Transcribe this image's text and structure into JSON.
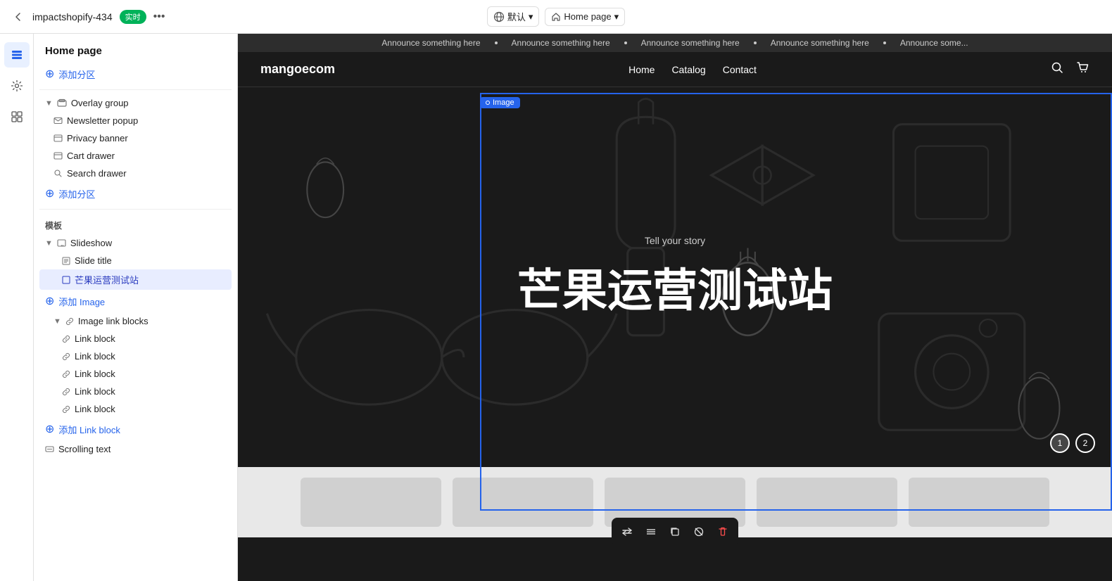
{
  "topbar": {
    "back_icon": "←",
    "store_name": "impactshopify-434",
    "live_badge": "实时",
    "more_icon": "•••",
    "lang_label": "默认",
    "lang_dropdown_icon": "▾",
    "page_label": "Home page",
    "page_dropdown_icon": "▾"
  },
  "sidebar_icons": [
    {
      "name": "layers-icon",
      "icon": "☰",
      "active": true
    },
    {
      "name": "settings-icon",
      "icon": "⚙"
    },
    {
      "name": "apps-icon",
      "icon": "⊞"
    }
  ],
  "left_panel": {
    "title": "Home page",
    "add_section_1_label": "添加分区",
    "overlay_group_label": "Overlay group",
    "overlay_items": [
      {
        "label": "Newsletter popup",
        "icon": "▣"
      },
      {
        "label": "Privacy banner",
        "icon": "▣"
      },
      {
        "label": "Cart drawer",
        "icon": "▣"
      },
      {
        "label": "Search drawer",
        "icon": "◎"
      }
    ],
    "add_section_2_label": "添加分区",
    "template_label": "模板",
    "slideshow_label": "Slideshow",
    "slide_title_label": "Slide title",
    "active_slide_label": "芒果运营测试站",
    "add_image_label": "添加 Image",
    "image_link_blocks_label": "Image link blocks",
    "link_blocks": [
      "Link block",
      "Link block",
      "Link block",
      "Link block",
      "Link block"
    ],
    "add_link_block_label": "添加 Link block",
    "scrolling_text_label": "Scrolling text"
  },
  "preview": {
    "announce_items": [
      "Announce something here",
      "Announce something here",
      "Announce something here",
      "Announce something here",
      "Announce some..."
    ],
    "shop_logo": "mangoecom",
    "nav_links": [
      "Home",
      "Catalog",
      "Contact"
    ],
    "hero_subtitle": "Tell your story",
    "hero_title": "芒果运营测试站",
    "slide_indicators": [
      "1",
      "2"
    ],
    "image_badge_label": "Image"
  },
  "bottom_toolbar": {
    "buttons": [
      {
        "icon": "⇄",
        "name": "swap-button"
      },
      {
        "icon": "≡",
        "name": "list-button"
      },
      {
        "icon": "©",
        "name": "copy-button"
      },
      {
        "icon": "⊘",
        "name": "hide-button"
      },
      {
        "icon": "🗑",
        "name": "delete-button",
        "red": true
      }
    ]
  },
  "colors": {
    "accent": "#2563eb",
    "live": "#00b259",
    "danger": "#ff4d4d",
    "sidebar_bg": "#fff",
    "preview_bg": "#1a1a1a"
  }
}
